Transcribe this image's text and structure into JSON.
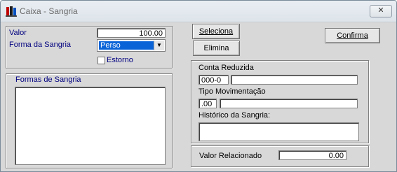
{
  "window": {
    "title": "Caixa - Sangria",
    "close_symbol": "✕"
  },
  "form": {
    "valor_label": "Valor",
    "valor_value": "100.00",
    "forma_label": "Forma da Sangria",
    "forma_value": "Perso",
    "estorno_label": "Estorno"
  },
  "formas": {
    "label": "Formas de Sangria"
  },
  "buttons": {
    "seleciona": "Seleciona",
    "elimina": "Elimina",
    "confirma": "Confirma"
  },
  "details": {
    "conta_label": "Conta Reduzida",
    "conta_code": "000-0",
    "conta_desc": "",
    "tipo_label": "Tipo Movimentação",
    "tipo_code": ".00",
    "tipo_desc": "",
    "historico_label": "Histórico da Sangria:",
    "historico_value": ""
  },
  "footer": {
    "valor_relacionado_label": "Valor Relacionado",
    "valor_relacionado_value": "0.00"
  }
}
